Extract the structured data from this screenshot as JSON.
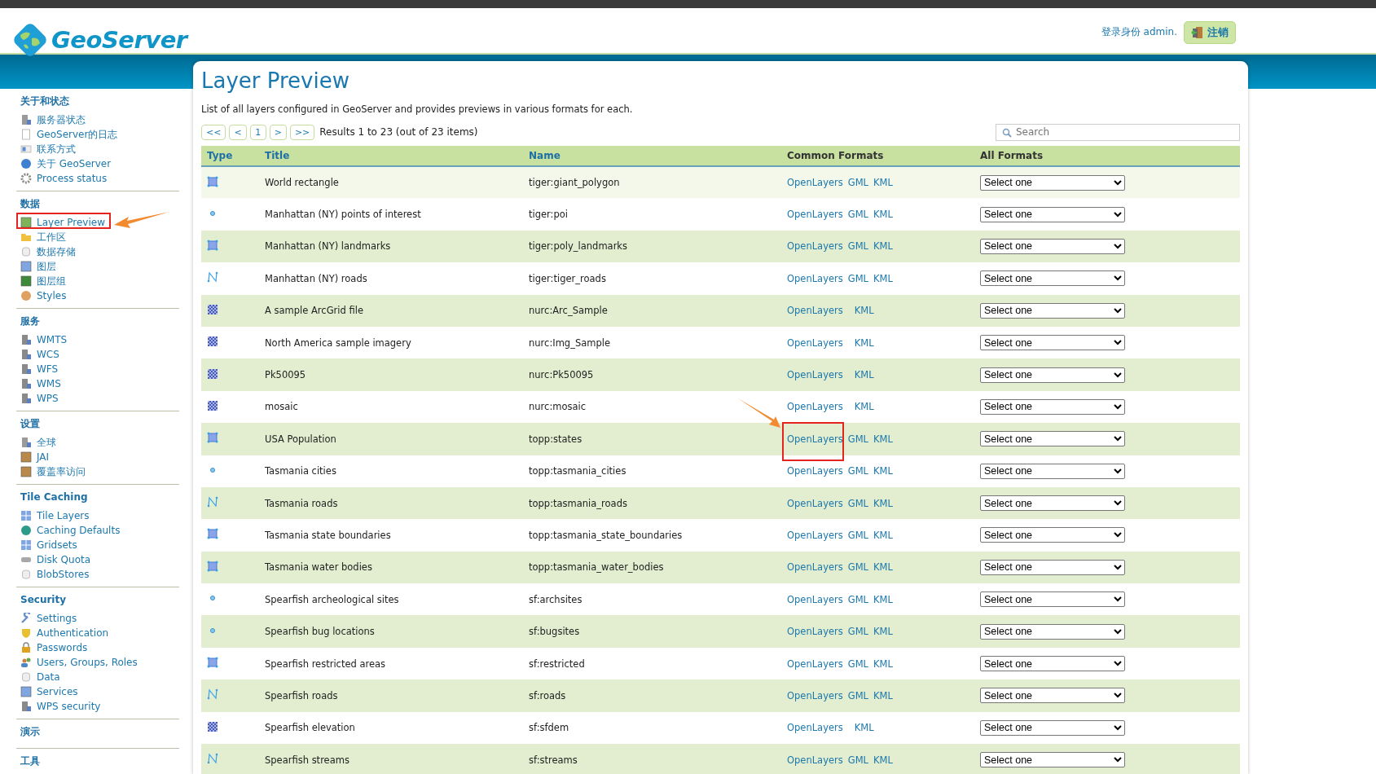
{
  "header": {
    "logo": "GeoServer",
    "user": "登录身份 admin.",
    "logout": "注销"
  },
  "sidebar": [
    {
      "heading": "关于和状态",
      "items": [
        {
          "label": "服务器状态"
        },
        {
          "label": "GeoServer的日志"
        },
        {
          "label": "联系方式"
        },
        {
          "label": "关于 GeoServer"
        },
        {
          "label": "Process status"
        }
      ]
    },
    {
      "heading": "数据",
      "items": [
        {
          "label": "Layer Preview"
        },
        {
          "label": "工作区"
        },
        {
          "label": "数据存储"
        },
        {
          "label": "图层"
        },
        {
          "label": "图层组"
        },
        {
          "label": "Styles"
        }
      ]
    },
    {
      "heading": "服务",
      "items": [
        {
          "label": "WMTS"
        },
        {
          "label": "WCS"
        },
        {
          "label": "WFS"
        },
        {
          "label": "WMS"
        },
        {
          "label": "WPS"
        }
      ]
    },
    {
      "heading": "设置",
      "items": [
        {
          "label": "全球"
        },
        {
          "label": "JAI"
        },
        {
          "label": "覆盖率访问"
        }
      ]
    },
    {
      "heading": "Tile Caching",
      "items": [
        {
          "label": "Tile Layers"
        },
        {
          "label": "Caching Defaults"
        },
        {
          "label": "Gridsets"
        },
        {
          "label": "Disk Quota"
        },
        {
          "label": "BlobStores"
        }
      ]
    },
    {
      "heading": "Security",
      "items": [
        {
          "label": "Settings"
        },
        {
          "label": "Authentication"
        },
        {
          "label": "Passwords"
        },
        {
          "label": "Users, Groups, Roles"
        },
        {
          "label": "Data"
        },
        {
          "label": "Services"
        },
        {
          "label": "WPS security"
        }
      ]
    },
    {
      "heading": "演示"
    },
    {
      "heading": "工具"
    }
  ],
  "page": {
    "title": "Layer Preview",
    "description": "List of all layers configured in GeoServer and provides previews in various formats for each.",
    "pager": [
      "<<",
      "<",
      "1",
      ">",
      ">>"
    ],
    "results": "Results 1 to 23 (out of 23 items)",
    "search": {
      "placeholder": "Search"
    }
  },
  "table": {
    "columns": [
      {
        "label": "Type",
        "sortable": true
      },
      {
        "label": "Title",
        "sortable": true
      },
      {
        "label": "Name",
        "sortable": true
      },
      {
        "label": "Common Formats",
        "sortable": false
      },
      {
        "label": "All Formats",
        "sortable": false
      }
    ],
    "rows": [
      {
        "kind": "polygon",
        "title": "World rectangle",
        "name": "tiger:giant_polygon",
        "formats": [
          "OpenLayers",
          "GML",
          "KML"
        ],
        "select": "Select one",
        "highlighted": true
      },
      {
        "kind": "point",
        "title": "Manhattan (NY) points of interest",
        "name": "tiger:poi",
        "formats": [
          "OpenLayers",
          "GML",
          "KML"
        ],
        "select": "Select one",
        "highlighted": false
      },
      {
        "kind": "polygon",
        "title": "Manhattan (NY) landmarks",
        "name": "tiger:poly_landmarks",
        "formats": [
          "OpenLayers",
          "GML",
          "KML"
        ],
        "select": "Select one",
        "highlighted": false
      },
      {
        "kind": "line",
        "title": "Manhattan (NY) roads",
        "name": "tiger:tiger_roads",
        "formats": [
          "OpenLayers",
          "GML",
          "KML"
        ],
        "select": "Select one",
        "highlighted": false
      },
      {
        "kind": "raster",
        "title": "A sample ArcGrid file",
        "name": "nurc:Arc_Sample",
        "formats": [
          "OpenLayers",
          "KML"
        ],
        "select": "Select one",
        "highlighted": false
      },
      {
        "kind": "raster",
        "title": "North America sample imagery",
        "name": "nurc:Img_Sample",
        "formats": [
          "OpenLayers",
          "KML"
        ],
        "select": "Select one",
        "highlighted": false
      },
      {
        "kind": "raster",
        "title": "Pk50095",
        "name": "nurc:Pk50095",
        "formats": [
          "OpenLayers",
          "KML"
        ],
        "select": "Select one",
        "highlighted": false
      },
      {
        "kind": "raster",
        "title": "mosaic",
        "name": "nurc:mosaic",
        "formats": [
          "OpenLayers",
          "KML"
        ],
        "select": "Select one",
        "highlighted": false
      },
      {
        "kind": "polygon",
        "title": "USA Population",
        "name": "topp:states",
        "formats": [
          "OpenLayers",
          "GML",
          "KML"
        ],
        "select": "Select one",
        "highlighted": false
      },
      {
        "kind": "point",
        "title": "Tasmania cities",
        "name": "topp:tasmania_cities",
        "formats": [
          "OpenLayers",
          "GML",
          "KML"
        ],
        "select": "Select one",
        "highlighted": false
      },
      {
        "kind": "line",
        "title": "Tasmania roads",
        "name": "topp:tasmania_roads",
        "formats": [
          "OpenLayers",
          "GML",
          "KML"
        ],
        "select": "Select one",
        "highlighted": false
      },
      {
        "kind": "polygon",
        "title": "Tasmania state boundaries",
        "name": "topp:tasmania_state_boundaries",
        "formats": [
          "OpenLayers",
          "GML",
          "KML"
        ],
        "select": "Select one",
        "highlighted": false
      },
      {
        "kind": "polygon",
        "title": "Tasmania water bodies",
        "name": "topp:tasmania_water_bodies",
        "formats": [
          "OpenLayers",
          "GML",
          "KML"
        ],
        "select": "Select one",
        "highlighted": false
      },
      {
        "kind": "point",
        "title": "Spearfish archeological sites",
        "name": "sf:archsites",
        "formats": [
          "OpenLayers",
          "GML",
          "KML"
        ],
        "select": "Select one",
        "highlighted": false
      },
      {
        "kind": "point",
        "title": "Spearfish bug locations",
        "name": "sf:bugsites",
        "formats": [
          "OpenLayers",
          "GML",
          "KML"
        ],
        "select": "Select one",
        "highlighted": false
      },
      {
        "kind": "polygon",
        "title": "Spearfish restricted areas",
        "name": "sf:restricted",
        "formats": [
          "OpenLayers",
          "GML",
          "KML"
        ],
        "select": "Select one",
        "highlighted": false
      },
      {
        "kind": "line",
        "title": "Spearfish roads",
        "name": "sf:roads",
        "formats": [
          "OpenLayers",
          "GML",
          "KML"
        ],
        "select": "Select one",
        "highlighted": false
      },
      {
        "kind": "raster",
        "title": "Spearfish elevation",
        "name": "sf:sfdem",
        "formats": [
          "OpenLayers",
          "KML"
        ],
        "select": "Select one",
        "highlighted": false
      },
      {
        "kind": "line",
        "title": "Spearfish streams",
        "name": "sf:streams",
        "formats": [
          "OpenLayers",
          "GML",
          "KML"
        ],
        "select": "Select one",
        "highlighted": false
      }
    ]
  }
}
